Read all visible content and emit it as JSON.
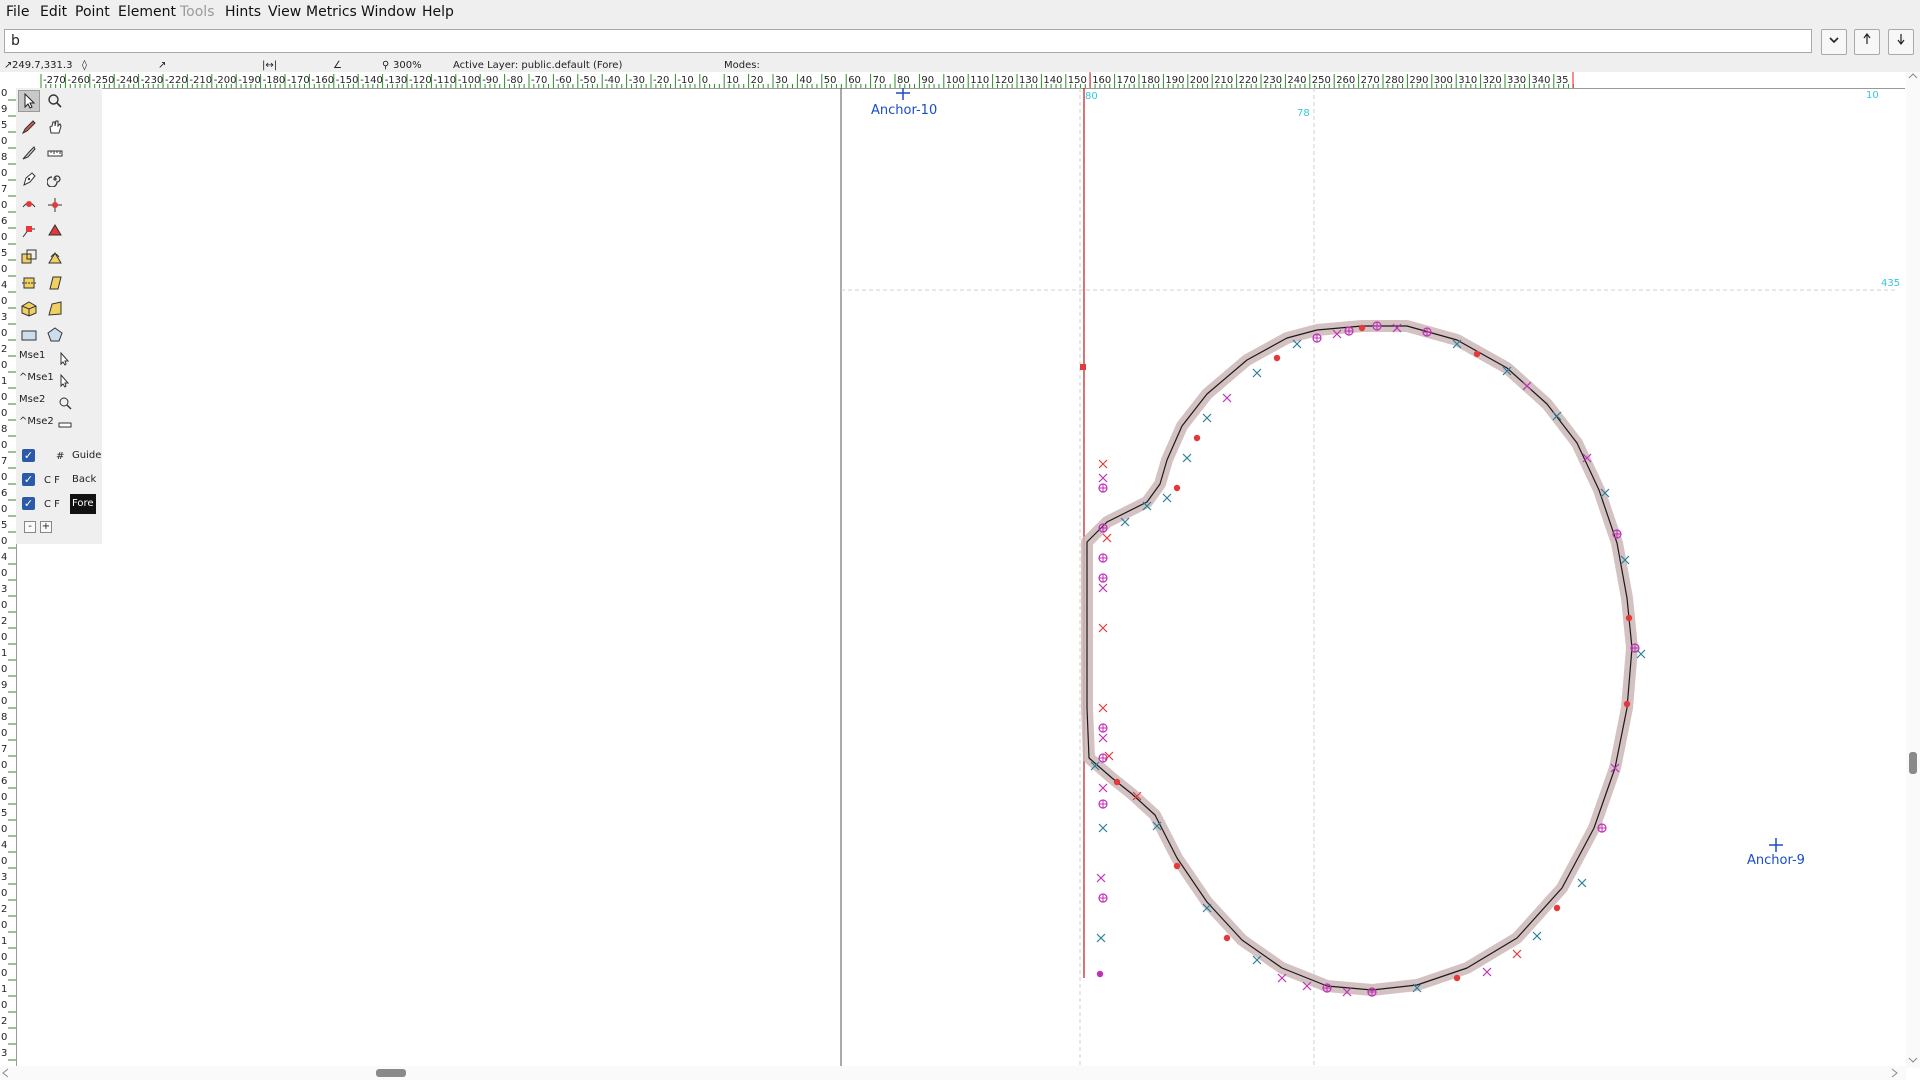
{
  "menu": [
    "File",
    "Edit",
    "Point",
    "Element",
    "Tools",
    "Hints",
    "View",
    "Metrics",
    "Window",
    "Help"
  ],
  "menu_disabled": [
    "Tools"
  ],
  "glyph_field": {
    "value": "b"
  },
  "info": {
    "coords": "249.7,331.3",
    "zoom": "300%",
    "active_layer": "Active Layer: public.default (Fore)",
    "modes": "Modes:"
  },
  "ruler_labels": [
    "-270",
    "-260",
    "-250",
    "-240",
    "-230",
    "-220",
    "-210",
    "-200",
    "-190",
    "-180",
    "-170",
    "-160",
    "-150",
    "-140",
    "-130",
    "-120",
    "-110",
    "-100",
    "-90",
    "-80",
    "-70",
    "-60",
    "-50",
    "-40",
    "-30",
    "-20",
    "-10",
    "0",
    "10",
    "20",
    "30",
    "40",
    "50",
    "60",
    "70",
    "80",
    "90",
    "100",
    "110",
    "120",
    "130",
    "140",
    "150",
    "160",
    "170",
    "180",
    "190",
    "200",
    "210",
    "220",
    "230",
    "240",
    "250",
    "260",
    "270",
    "280",
    "290",
    "300",
    "310",
    "320",
    "330",
    "340",
    "35"
  ],
  "vruler_digits": [
    "0",
    "9",
    "5",
    "0",
    "8",
    "0",
    "7",
    "0",
    "6",
    "0",
    "5",
    "0",
    "4",
    "0",
    "3",
    "0",
    "2",
    "0",
    "1",
    "0",
    "0",
    "8",
    "0",
    "7",
    "0",
    "6",
    "0",
    "5",
    "0",
    "4",
    "0",
    "3",
    "0",
    "2",
    "0",
    "1",
    "0",
    "9",
    "0",
    "8",
    "0",
    "7",
    "0",
    "6",
    "0",
    "5",
    "0",
    "4",
    "0",
    "3",
    "0",
    "2",
    "0",
    "1",
    "0",
    "0",
    "1",
    "0",
    "2",
    "0",
    "3"
  ],
  "mouse_bindings": [
    "Mse1",
    "^Mse1",
    "Mse2",
    "^Mse2"
  ],
  "layers": [
    {
      "code": "#",
      "name": "Guide",
      "checked": true,
      "selected": false
    },
    {
      "code": "C F",
      "name": "Back",
      "checked": true,
      "selected": false
    },
    {
      "code": "C F",
      "name": "Fore",
      "checked": true,
      "selected": true
    }
  ],
  "layer_buttons": [
    "-",
    "+"
  ],
  "anchors": [
    {
      "name": "Anchor-10"
    },
    {
      "name": "Anchor-9"
    }
  ],
  "guide_labels": {
    "top_left": "80",
    "vertical": "78",
    "horizontal": "435",
    "top_right": "10"
  },
  "colors": {
    "ruler_tick": "#2e8b2e",
    "anchor": "#1a4cc8",
    "guide": "#32c8d8",
    "point_red": "#e23a3a",
    "point_magenta": "#c030b8",
    "point_teal": "#2a7f9a",
    "outline_fill": "#cdb6b6",
    "vert_line": "#c01818"
  }
}
